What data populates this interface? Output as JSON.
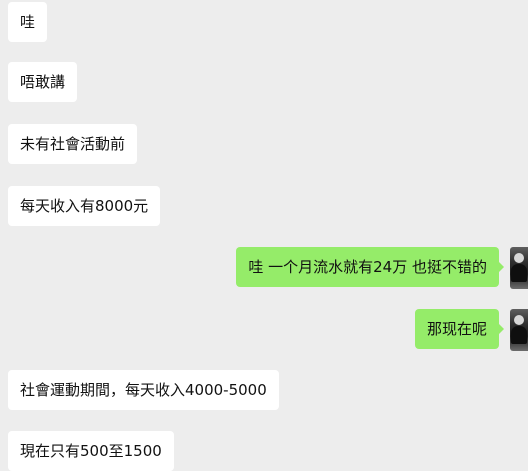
{
  "chat": {
    "messages": [
      {
        "direction": "in",
        "text": "哇"
      },
      {
        "direction": "in",
        "text": "唔敢講"
      },
      {
        "direction": "in",
        "text": "未有社會活動前"
      },
      {
        "direction": "in",
        "text": "每天收入有8000元"
      },
      {
        "direction": "out",
        "text": "哇 一个月流水就有24万  也挺不错的",
        "avatar": "user-avatar-icon"
      },
      {
        "direction": "out",
        "text": "那现在呢",
        "avatar": "user-avatar-icon"
      },
      {
        "direction": "in",
        "text": "社會運動期間，每天收入4000-5000"
      },
      {
        "direction": "in",
        "text": "現在只有500至1500"
      }
    ]
  },
  "colors": {
    "background": "#ededed",
    "incoming_bubble": "#ffffff",
    "outgoing_bubble": "#95ec69",
    "text": "#111111"
  }
}
